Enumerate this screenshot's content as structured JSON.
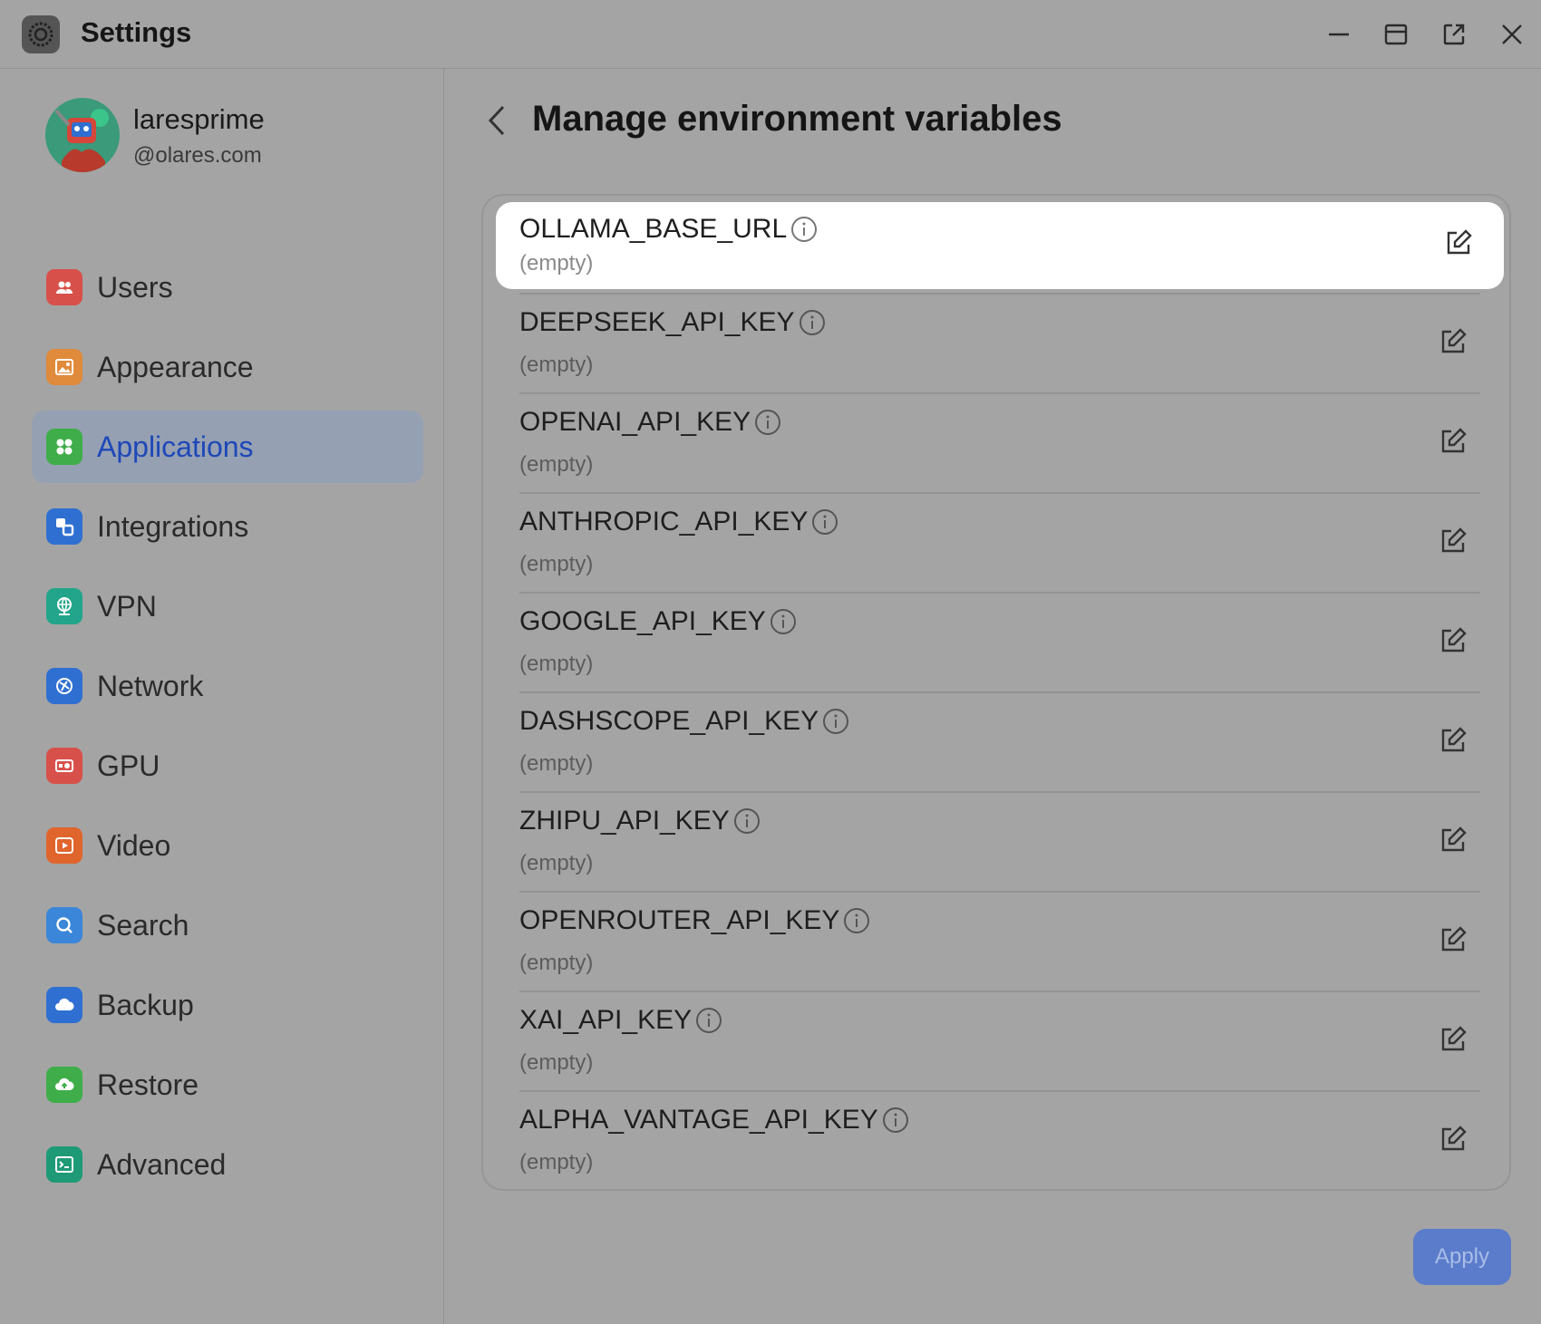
{
  "window": {
    "title": "Settings",
    "controls": [
      "minimize-icon",
      "maximize-icon",
      "popout-icon",
      "close-icon"
    ]
  },
  "user": {
    "name": "laresprime",
    "domain": "@olares.com"
  },
  "sidebar": {
    "items": [
      {
        "label": "Users",
        "icon": "users-icon",
        "color": "#d8504a"
      },
      {
        "label": "Appearance",
        "icon": "appearance-icon",
        "color": "#e08a3c"
      },
      {
        "label": "Applications",
        "icon": "applications-icon",
        "color": "#3fae4a",
        "active": true
      },
      {
        "label": "Integrations",
        "icon": "integrations-icon",
        "color": "#2f6fd1"
      },
      {
        "label": "VPN",
        "icon": "vpn-icon",
        "color": "#22a58a"
      },
      {
        "label": "Network",
        "icon": "network-icon",
        "color": "#2f6fd1"
      },
      {
        "label": "GPU",
        "icon": "gpu-icon",
        "color": "#d8504a"
      },
      {
        "label": "Video",
        "icon": "video-icon",
        "color": "#e0652c"
      },
      {
        "label": "Search",
        "icon": "search-icon",
        "color": "#3b86d8"
      },
      {
        "label": "Backup",
        "icon": "backup-icon",
        "color": "#2f6fd1"
      },
      {
        "label": "Restore",
        "icon": "restore-icon",
        "color": "#3fae4a"
      },
      {
        "label": "Advanced",
        "icon": "advanced-icon",
        "color": "#1f9a76"
      }
    ]
  },
  "main": {
    "title": "Manage environment variables",
    "variables": [
      {
        "key": "OLLAMA_BASE_URL",
        "value": "(empty)"
      },
      {
        "key": "DEEPSEEK_API_KEY",
        "value": "(empty)"
      },
      {
        "key": "OPENAI_API_KEY",
        "value": "(empty)"
      },
      {
        "key": "ANTHROPIC_API_KEY",
        "value": "(empty)"
      },
      {
        "key": "GOOGLE_API_KEY",
        "value": "(empty)"
      },
      {
        "key": "DASHSCOPE_API_KEY",
        "value": "(empty)"
      },
      {
        "key": "ZHIPU_API_KEY",
        "value": "(empty)"
      },
      {
        "key": "OPENROUTER_API_KEY",
        "value": "(empty)"
      },
      {
        "key": "XAI_API_KEY",
        "value": "(empty)"
      },
      {
        "key": "ALPHA_VANTAGE_API_KEY",
        "value": "(empty)"
      }
    ],
    "apply_label": "Apply"
  },
  "colors": {
    "accent": "#1e48b8",
    "active_bg": "#95a0b3",
    "apply_bg": "#5b7ccb"
  }
}
